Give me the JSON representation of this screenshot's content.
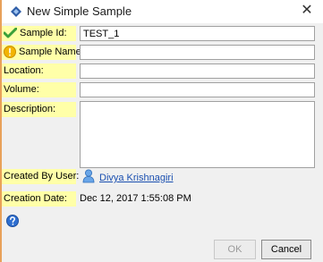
{
  "window": {
    "title": "New Simple Sample",
    "close_glyph": "✕"
  },
  "fields": {
    "sample_id": {
      "label": "Sample Id:",
      "value": "TEST_1"
    },
    "sample_name": {
      "label": "Sample Name:",
      "value": ""
    },
    "location": {
      "label": "Location:",
      "value": ""
    },
    "volume": {
      "label": "Volume:",
      "value": ""
    },
    "description": {
      "label": "Description:",
      "value": ""
    },
    "created_by": {
      "label": "Created By User:",
      "value": "Divya Krishnagiri"
    },
    "creation_date": {
      "label": "Creation Date:",
      "value": "Dec 12, 2017 1:55:08 PM"
    }
  },
  "buttons": {
    "ok": "OK",
    "cancel": "Cancel"
  },
  "colors": {
    "label_bg": "#ffffa8",
    "link": "#1a4fb0",
    "form_bg": "#f0f0f0"
  },
  "icons": [
    "window-app-icon",
    "checkmark-icon",
    "warning-icon",
    "user-icon",
    "help-icon",
    "close-icon"
  ]
}
